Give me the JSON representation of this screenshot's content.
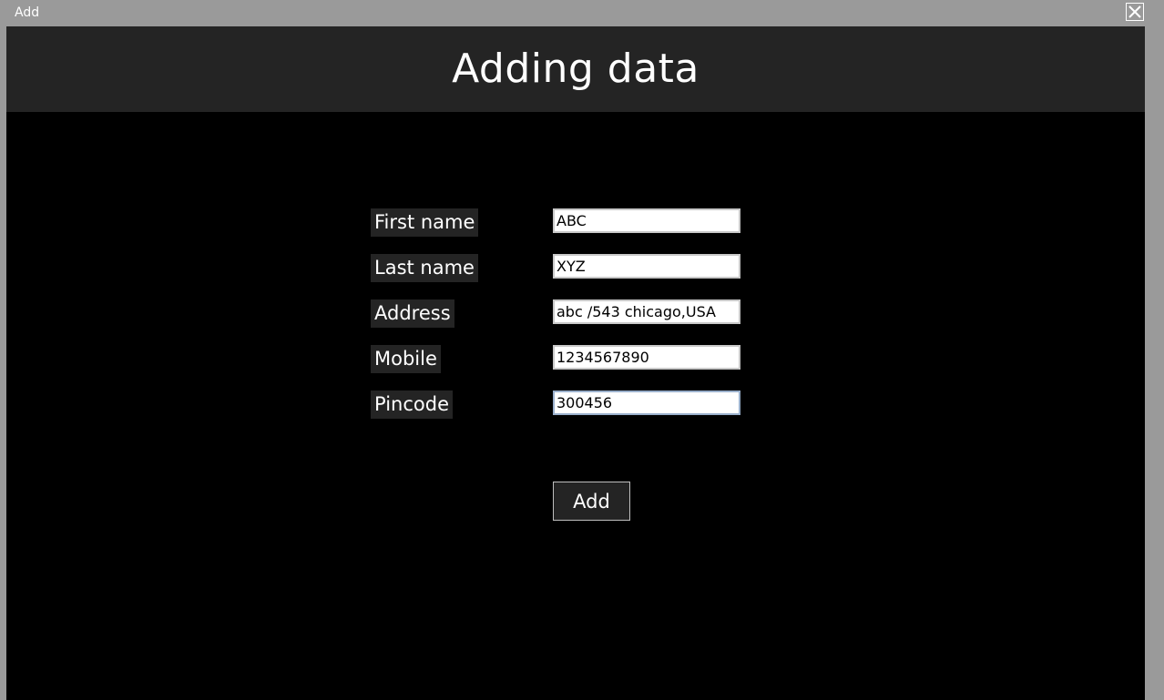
{
  "window": {
    "title": "Add",
    "close_icon": "close-icon"
  },
  "header": {
    "title": "Adding data"
  },
  "form": {
    "fields": [
      {
        "label": "First name",
        "value": "ABC"
      },
      {
        "label": "Last name",
        "value": "XYZ"
      },
      {
        "label": "Address",
        "value": "abc /543 chicago,USA"
      },
      {
        "label": "Mobile",
        "value": "1234567890"
      },
      {
        "label": "Pincode",
        "value": "300456"
      }
    ],
    "submit_label": "Add"
  },
  "colors": {
    "titlebar": "#9a9a9a",
    "header_bg": "#242424",
    "content_bg": "#000000",
    "label_bg": "#242424",
    "text": "#ffffff"
  }
}
